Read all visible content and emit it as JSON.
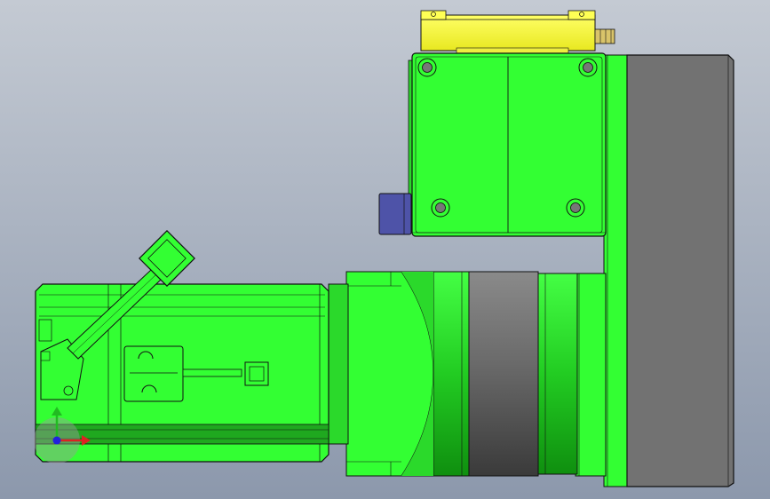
{
  "viewport": {
    "background_top": "#c4cad3",
    "background_bottom": "#8c98ac"
  },
  "colors": {
    "body_green": "#33ff33",
    "body_green_light": "#66ff55",
    "body_green_dark": "#1fa81f",
    "edge": "#111111",
    "gearbox_band": "#555555",
    "gearbox_band_light": "#8a8a8a",
    "mount_plate": "#727272",
    "yellow_part": "#ffff44",
    "connector_blue": "#4e53a8",
    "brass": "#b8a44a"
  },
  "model": {
    "parts": [
      "servo-motor",
      "gearbox",
      "mounting-plate",
      "upper-actuator-block",
      "yellow-sensor",
      "cable-connector",
      "side-connector"
    ]
  },
  "triad": {
    "axis_y_color": "#22bb22",
    "axis_x_color": "#dd2222",
    "axis_z_color": "#2222dd"
  }
}
